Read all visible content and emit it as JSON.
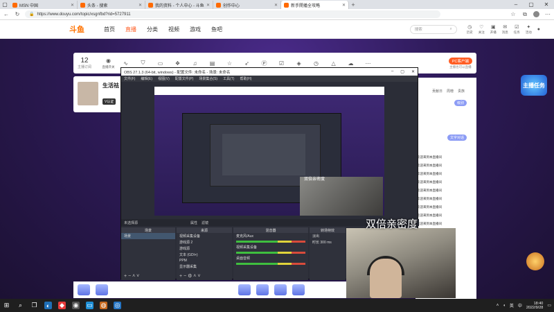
{
  "browser": {
    "tabs": [
      {
        "label": "MSN 中国",
        "active": false
      },
      {
        "label": "头条 - 搜索",
        "active": false
      },
      {
        "label": "我的资料 - 个人中心 - 斗鱼",
        "active": false
      },
      {
        "label": "创作中心",
        "active": false
      },
      {
        "label": "新手開播全攻略",
        "active": true
      }
    ],
    "url": "https://www.douyu.com/topic/xsgnfbd?rid=5727911"
  },
  "site": {
    "logo": "斗鱼",
    "nav": [
      "首页",
      "直播",
      "分类",
      "视频",
      "游戏",
      "鱼吧"
    ],
    "nav_active_index": 1,
    "search_placeholder": "搜索",
    "header_icons": [
      {
        "icon": "history-icon",
        "label": "历史"
      },
      {
        "icon": "follow-icon",
        "label": "关注"
      },
      {
        "icon": "live-icon",
        "label": "开播"
      },
      {
        "icon": "message-icon",
        "label": "消息"
      },
      {
        "icon": "task-icon",
        "label": "任务"
      },
      {
        "icon": "bulb-icon",
        "label": "活动"
      },
      {
        "icon": "download-icon",
        "label": "下载"
      }
    ]
  },
  "room": {
    "follow_count": "12",
    "follow_label": "主播订阅",
    "tools": [
      "直播开关",
      "",
      "",
      "",
      "",
      "",
      "",
      "",
      "",
      "",
      "",
      "",
      "",
      "",
      "",
      "",
      ""
    ],
    "pc_live_button": "PC客户端",
    "pc_live_note": "主播也可以直播",
    "streamer_name": "生活祛",
    "v_badge": "V认证",
    "right_tabs": [
      "贡献日",
      "周榜",
      "贵族"
    ],
    "right_btn_1": "级别",
    "right_btn_2": "文字对话",
    "chat": [
      {
        "user": "",
        "text": "欢迎来到本直播间"
      },
      {
        "user": "",
        "text": "欢迎来到本直播间"
      },
      {
        "user": "",
        "text": "欢迎来到本直播间"
      },
      {
        "user": "",
        "text": "欢迎来到本直播间"
      },
      {
        "user": "",
        "text": "欢迎来到本直播间"
      },
      {
        "user": "",
        "text": "欢迎来到本直播间"
      },
      {
        "user": "",
        "text": "欢迎来到本直播间"
      },
      {
        "user": "",
        "text": "欢迎来到本直播间"
      },
      {
        "user": "",
        "text": "欢迎来到本直播间"
      }
    ],
    "task_badge": "主播任务"
  },
  "obs": {
    "title": "OBS 27.1.3 (64-bit, windows) - 配置文件: 未命名 - 场景: 未命名",
    "menu": [
      "文件(F)",
      "编辑(E)",
      "视图(V)",
      "配置文件(P)",
      "场景集合(S)",
      "工具(T)",
      "帮助(H)"
    ],
    "status": "未选择源",
    "status_buttons": [
      "属性",
      "滤镜"
    ],
    "docks": {
      "scenes": {
        "title": "场景",
        "items": [
          "场景"
        ]
      },
      "sources": {
        "title": "来源",
        "items": [
          "视频采集设备",
          "游戏源 2",
          "游戏源",
          "文本 (GDI+)",
          "PPM",
          "显示器采集"
        ]
      },
      "mixer": {
        "title": "混音器",
        "channels": [
          "麦克风/Aux",
          "视频采集设备",
          "桌面音频"
        ]
      },
      "transitions": {
        "title": "转场特效",
        "items": [
          "淡出",
          "时长"
        ],
        "duration": "300 ms"
      }
    },
    "preview_cam_label": "双倍亲密度"
  },
  "webcam_label": "双倍亲密度",
  "taskbar": {
    "time": "18:40",
    "date": "2022/9/28",
    "tray": [
      "英",
      "中"
    ]
  }
}
